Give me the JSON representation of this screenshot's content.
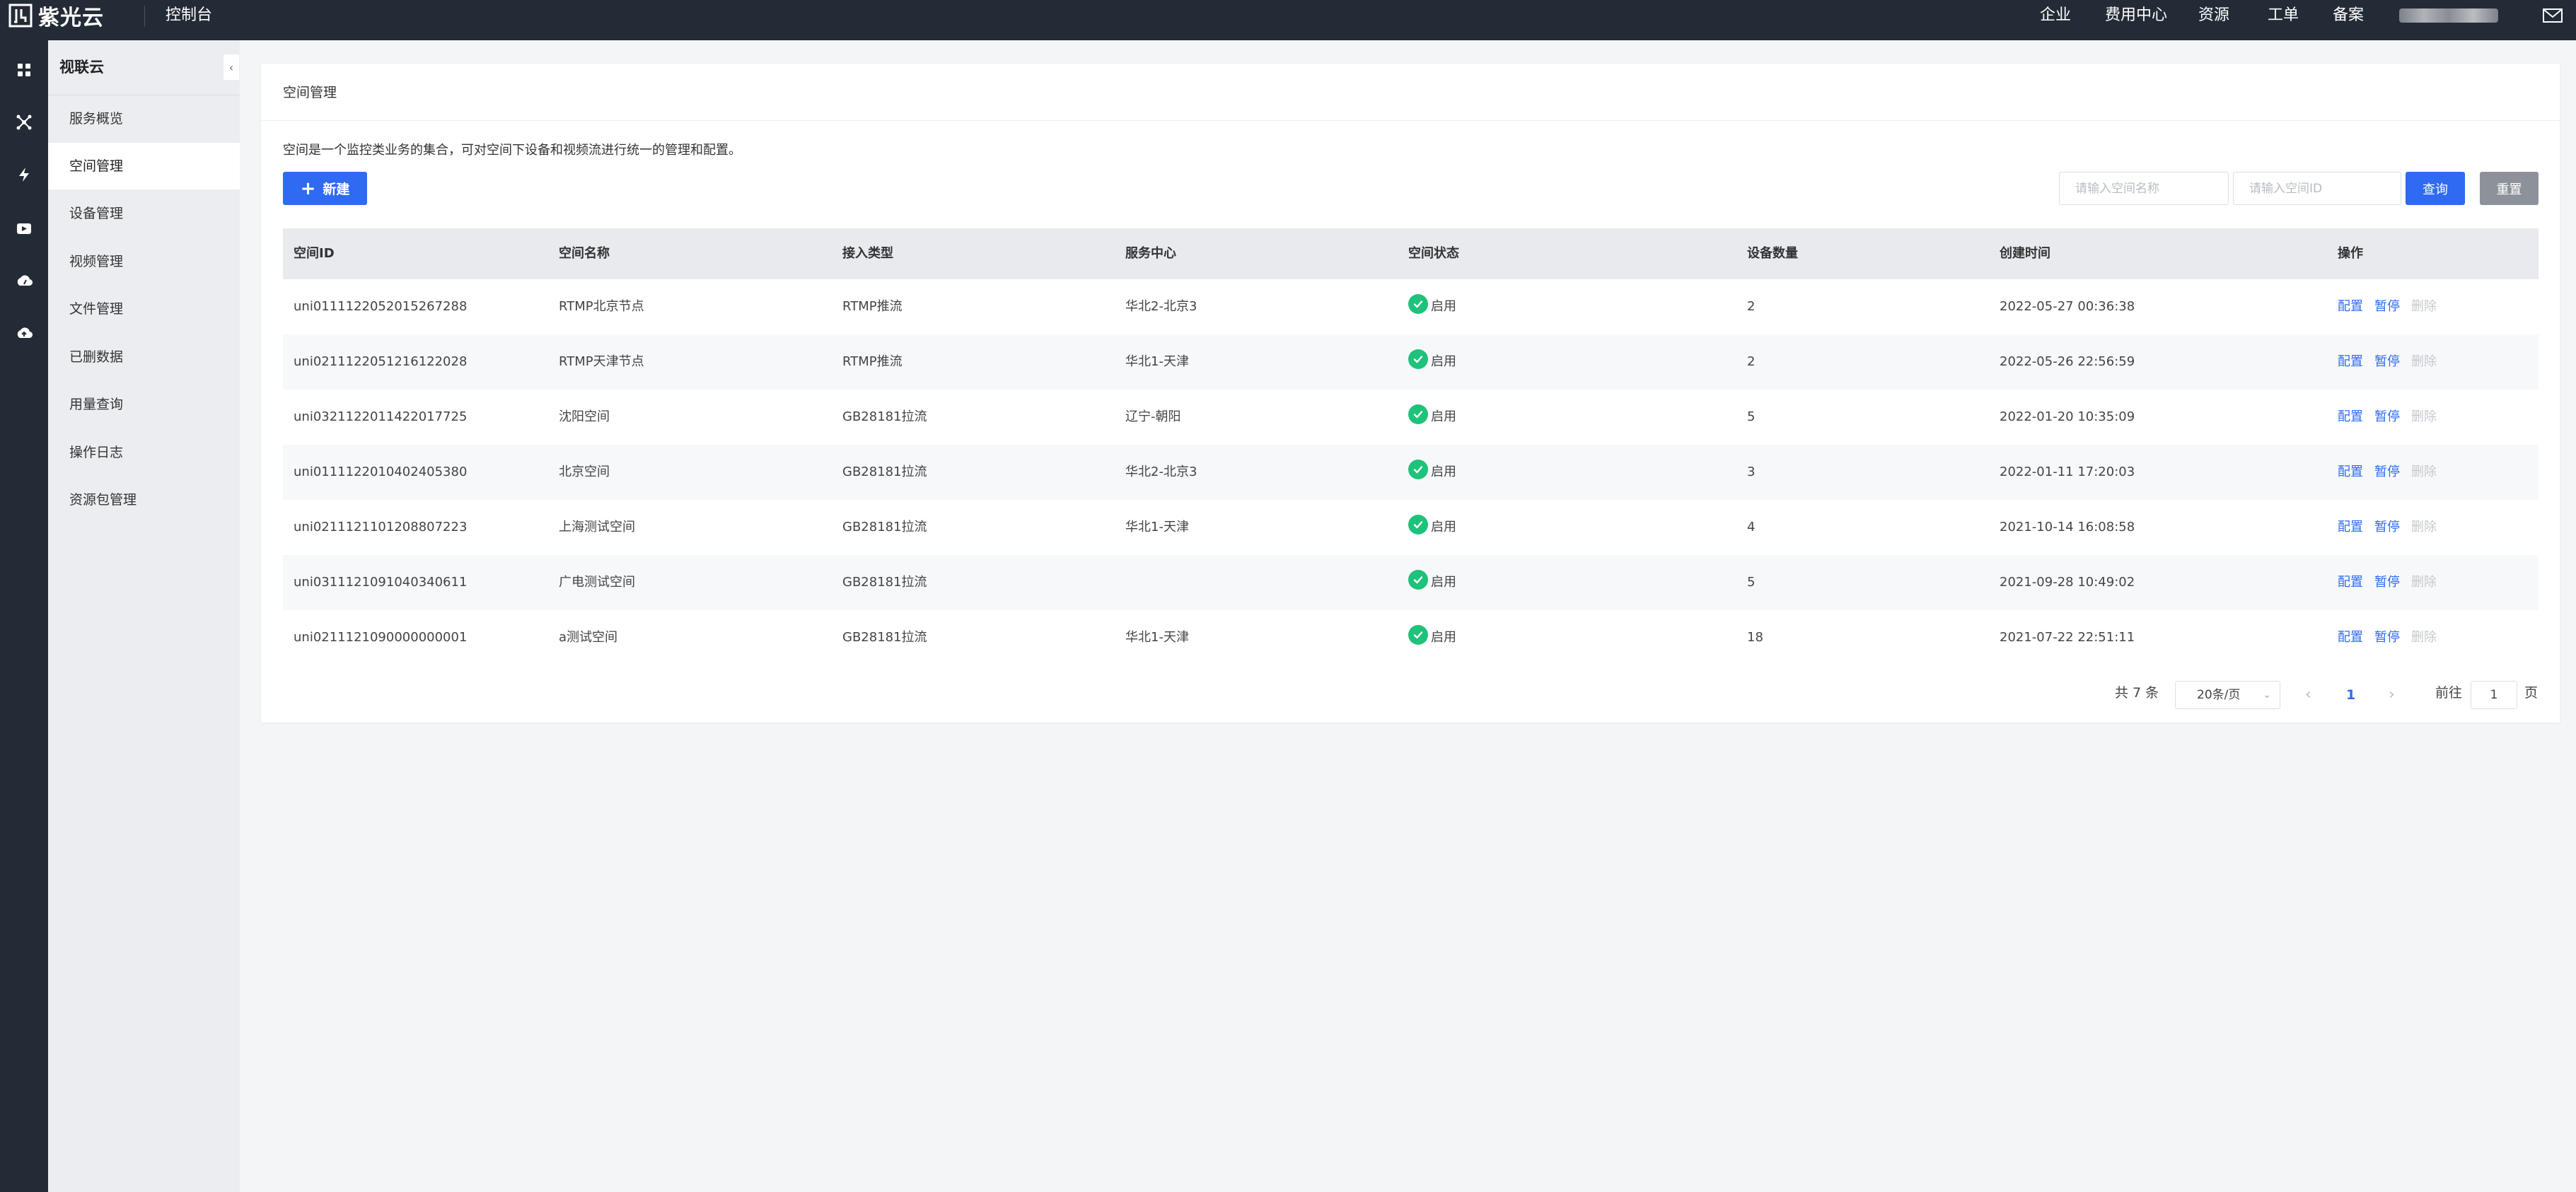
{
  "brand": {
    "name": "紫光云",
    "console": "控制台"
  },
  "top_nav": [
    "企业",
    "费用中心",
    "资源",
    "工单",
    "备案"
  ],
  "rail_icons": [
    "grid-icon",
    "network-icon",
    "bolt-icon",
    "video-icon",
    "cloud-dashboard-icon",
    "cloud-upload-icon"
  ],
  "sidebar": {
    "title": "视联云",
    "collapse": "‹",
    "items": [
      {
        "label": "服务概览"
      },
      {
        "label": "空间管理"
      },
      {
        "label": "设备管理"
      },
      {
        "label": "视频管理"
      },
      {
        "label": "文件管理"
      },
      {
        "label": "已删数据"
      },
      {
        "label": "用量查询"
      },
      {
        "label": "操作日志"
      },
      {
        "label": "资源包管理"
      }
    ]
  },
  "main": {
    "title": "空间管理",
    "description": "空间是一个监控类业务的集合，可对空间下设备和视频流进行统一的管理和配置。",
    "new_button": "新建",
    "search_name_placeholder": "请输入空间名称",
    "search_id_placeholder": "请输入空间ID",
    "query_button": "查询",
    "reset_button": "重置"
  },
  "table": {
    "headers": [
      "空间ID",
      "空间名称",
      "接入类型",
      "服务中心",
      "空间状态",
      "设备数量",
      "创建时间",
      "操作"
    ],
    "actions": {
      "config": "配置",
      "pause": "暂停",
      "delete": "删除"
    },
    "rows": [
      {
        "id": "uni0111122052015267288",
        "name": "RTMP北京节点",
        "type": "RTMP推流",
        "center": "华北2-北京3",
        "status": "启用",
        "devices": "2",
        "created": "2022-05-27 00:36:38"
      },
      {
        "id": "uni0211122051216122028",
        "name": "RTMP天津节点",
        "type": "RTMP推流",
        "center": "华北1-天津",
        "status": "启用",
        "devices": "2",
        "created": "2022-05-26 22:56:59"
      },
      {
        "id": "uni0321122011422017725",
        "name": "沈阳空间",
        "type": "GB28181拉流",
        "center": "辽宁-朝阳",
        "status": "启用",
        "devices": "5",
        "created": "2022-01-20 10:35:09"
      },
      {
        "id": "uni0111122010402405380",
        "name": "北京空间",
        "type": "GB28181拉流",
        "center": "华北2-北京3",
        "status": "启用",
        "devices": "3",
        "created": "2022-01-11 17:20:03"
      },
      {
        "id": "uni0211121101208807223",
        "name": "上海测试空间",
        "type": "GB28181拉流",
        "center": "华北1-天津",
        "status": "启用",
        "devices": "4",
        "created": "2021-10-14 16:08:58"
      },
      {
        "id": "uni0311121091040340611",
        "name": "广电测试空间",
        "type": "GB28181拉流",
        "center": "",
        "status": "启用",
        "devices": "5",
        "created": "2021-09-28 10:49:02"
      },
      {
        "id": "uni0211121090000000001",
        "name": "a测试空间",
        "type": "GB28181拉流",
        "center": "华北1-天津",
        "status": "启用",
        "devices": "18",
        "created": "2021-07-22 22:51:11"
      }
    ]
  },
  "pagination": {
    "total": "共 7 条",
    "page_size": "20条/页",
    "current_page": "1",
    "goto_label": "前往",
    "goto_value": "1",
    "page_suffix": "页"
  },
  "colors": {
    "primary": "#2f6bf2",
    "success": "#1ec27a",
    "dark": "#232b36"
  }
}
